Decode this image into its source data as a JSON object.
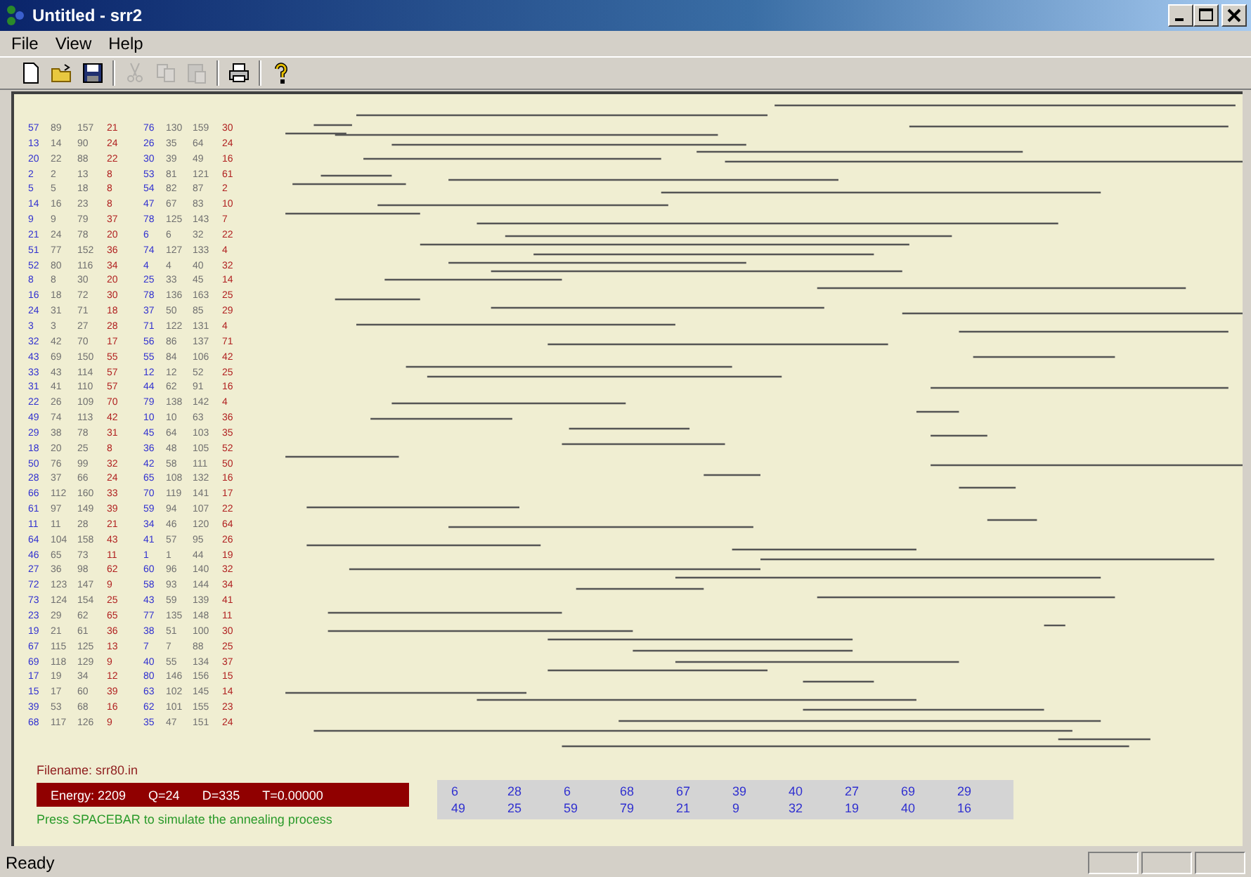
{
  "window": {
    "title": "Untitled - srr2"
  },
  "menu": [
    "File",
    "View",
    "Help"
  ],
  "toolbar": [
    {
      "kind": "new",
      "disabled": false
    },
    {
      "kind": "open",
      "disabled": false
    },
    {
      "kind": "save",
      "disabled": false
    },
    {
      "kind": "sep"
    },
    {
      "kind": "cut",
      "disabled": true
    },
    {
      "kind": "copy",
      "disabled": true
    },
    {
      "kind": "paste",
      "disabled": true
    },
    {
      "kind": "sep"
    },
    {
      "kind": "print",
      "disabled": false
    },
    {
      "kind": "sep"
    },
    {
      "kind": "help",
      "disabled": false
    }
  ],
  "table": {
    "rows": [
      [
        "57",
        "89",
        "157",
        "21",
        "76",
        "130",
        "159",
        "30"
      ],
      [
        "13",
        "14",
        "90",
        "24",
        "26",
        "35",
        "64",
        "24"
      ],
      [
        "20",
        "22",
        "88",
        "22",
        "30",
        "39",
        "49",
        "16"
      ],
      [
        "2",
        "2",
        "13",
        "8",
        "53",
        "81",
        "121",
        "61"
      ],
      [
        "5",
        "5",
        "18",
        "8",
        "54",
        "82",
        "87",
        "2"
      ],
      [
        "14",
        "16",
        "23",
        "8",
        "47",
        "67",
        "83",
        "10"
      ],
      [
        "9",
        "9",
        "79",
        "37",
        "78",
        "125",
        "143",
        "7"
      ],
      [
        "21",
        "24",
        "78",
        "20",
        "6",
        "6",
        "32",
        "22"
      ],
      [
        "51",
        "77",
        "152",
        "36",
        "74",
        "127",
        "133",
        "4"
      ],
      [
        "52",
        "80",
        "116",
        "34",
        "4",
        "4",
        "40",
        "32"
      ],
      [
        "8",
        "8",
        "30",
        "20",
        "25",
        "33",
        "45",
        "14"
      ],
      [
        "16",
        "18",
        "72",
        "30",
        "78",
        "136",
        "163",
        "25"
      ],
      [
        "24",
        "31",
        "71",
        "18",
        "37",
        "50",
        "85",
        "29"
      ],
      [
        "3",
        "3",
        "27",
        "28",
        "71",
        "122",
        "131",
        "4"
      ],
      [
        "32",
        "42",
        "70",
        "17",
        "56",
        "86",
        "137",
        "71"
      ],
      [
        "43",
        "69",
        "150",
        "55",
        "55",
        "84",
        "106",
        "42"
      ],
      [
        "33",
        "43",
        "114",
        "57",
        "12",
        "12",
        "52",
        "25"
      ],
      [
        "31",
        "41",
        "110",
        "57",
        "44",
        "62",
        "91",
        "16"
      ],
      [
        "22",
        "26",
        "109",
        "70",
        "79",
        "138",
        "142",
        "4"
      ],
      [
        "49",
        "74",
        "113",
        "42",
        "10",
        "10",
        "63",
        "36"
      ],
      [
        "29",
        "38",
        "78",
        "31",
        "45",
        "64",
        "103",
        "35"
      ],
      [
        "18",
        "20",
        "25",
        "8",
        "36",
        "48",
        "105",
        "52"
      ],
      [
        "50",
        "76",
        "99",
        "32",
        "42",
        "58",
        "111",
        "50"
      ],
      [
        "28",
        "37",
        "66",
        "24",
        "65",
        "108",
        "132",
        "16"
      ],
      [
        "66",
        "112",
        "160",
        "33",
        "70",
        "119",
        "141",
        "17"
      ],
      [
        "61",
        "97",
        "149",
        "39",
        "59",
        "94",
        "107",
        "22"
      ],
      [
        "11",
        "11",
        "28",
        "21",
        "34",
        "46",
        "120",
        "64"
      ],
      [
        "64",
        "104",
        "158",
        "43",
        "41",
        "57",
        "95",
        "26"
      ],
      [
        "46",
        "65",
        "73",
        "11",
        "1",
        "1",
        "44",
        "19"
      ],
      [
        "27",
        "36",
        "98",
        "62",
        "60",
        "96",
        "140",
        "32"
      ],
      [
        "72",
        "123",
        "147",
        "9",
        "58",
        "93",
        "144",
        "34"
      ],
      [
        "73",
        "124",
        "154",
        "25",
        "43",
        "59",
        "139",
        "41"
      ],
      [
        "23",
        "29",
        "62",
        "65",
        "77",
        "135",
        "148",
        "11"
      ],
      [
        "19",
        "21",
        "61",
        "36",
        "38",
        "51",
        "100",
        "30"
      ],
      [
        "67",
        "115",
        "125",
        "13",
        "7",
        "7",
        "88",
        "25"
      ],
      [
        "69",
        "118",
        "129",
        "9",
        "40",
        "55",
        "134",
        "37"
      ],
      [
        "17",
        "19",
        "34",
        "12",
        "80",
        "146",
        "156",
        "15"
      ],
      [
        "15",
        "17",
        "60",
        "39",
        "63",
        "102",
        "145",
        "14"
      ],
      [
        "39",
        "53",
        "68",
        "16",
        "62",
        "101",
        "155",
        "23"
      ],
      [
        "68",
        "117",
        "126",
        "9",
        "35",
        "47",
        "151",
        "24"
      ]
    ]
  },
  "filename": "Filename: srr80.in",
  "energy": [
    "Energy: 2209",
    "Q=24",
    "D=335",
    "T=0.00000"
  ],
  "hint": "Press SPACEBAR to simulate the annealing process",
  "sequence": [
    [
      "6",
      "28",
      "6",
      "68",
      "67",
      "39",
      "40",
      "27",
      "69",
      "29"
    ],
    [
      "49",
      "25",
      "59",
      "79",
      "21",
      "9",
      "32",
      "19",
      "40",
      "16"
    ]
  ],
  "status_bar": {
    "text": "Ready"
  }
}
